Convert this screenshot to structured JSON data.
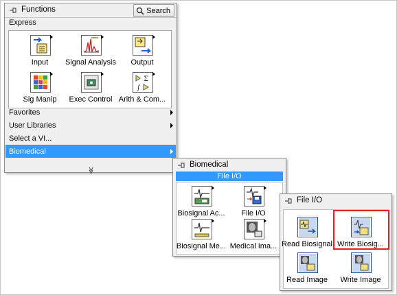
{
  "functions_palette": {
    "title": "Functions",
    "search_label": "Search",
    "express_label": "Express",
    "tiles": [
      {
        "label": "Input",
        "icon": "input-icon"
      },
      {
        "label": "Signal Analysis",
        "icon": "signal-analysis-icon"
      },
      {
        "label": "Output",
        "icon": "output-icon"
      },
      {
        "label": "Sig Manip",
        "icon": "sig-manip-icon"
      },
      {
        "label": "Exec Control",
        "icon": "exec-control-icon"
      },
      {
        "label": "Arith & Com...",
        "icon": "arith-compare-icon"
      }
    ],
    "rows": [
      {
        "label": "Favorites"
      },
      {
        "label": "User Libraries"
      },
      {
        "label": "Select a VI..."
      },
      {
        "label": "Biomedical",
        "selected": true
      }
    ],
    "more_glyph": "≫"
  },
  "biomedical_palette": {
    "title": "Biomedical",
    "section_label": "File I/O",
    "tiles": [
      {
        "label": "Biosignal Ac...",
        "icon": "biosignal-acquisition-icon"
      },
      {
        "label": "File I/O",
        "icon": "file-io-icon"
      },
      {
        "label": "Biosignal Me...",
        "icon": "biosignal-measure-icon"
      },
      {
        "label": "Medical Ima...",
        "icon": "medical-image-icon"
      }
    ]
  },
  "fileio_palette": {
    "title": "File I/O",
    "tiles": [
      {
        "label": "Read Biosignal",
        "icon": "read-biosignal-icon"
      },
      {
        "label": "Write Biosig...",
        "icon": "write-biosignal-icon",
        "highlighted": true
      },
      {
        "label": "Read Image",
        "icon": "read-image-icon"
      },
      {
        "label": "Write Image",
        "icon": "write-image-icon"
      }
    ]
  },
  "colors": {
    "selection": "#3399ff",
    "highlight": "#e0202a",
    "palette_bg": "#f0f0f0"
  }
}
